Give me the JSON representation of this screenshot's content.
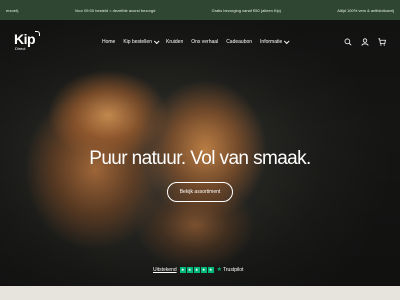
{
  "announcement": {
    "left": "erzoet)",
    "center_left": "Voor 09:00 besteld = dezelfde avond bezorgd",
    "center_right": "Gratis bezorging vanaf €50 (alleen Kip)",
    "right": "Altijd 100% vers & antibioticavrij",
    "background": "#2f4732"
  },
  "logo": {
    "main": "Kip",
    "sub": "Direct"
  },
  "nav": {
    "items": [
      {
        "label": "Home"
      },
      {
        "label": "Kip bestellen"
      },
      {
        "label": "Kruiden"
      },
      {
        "label": "Ons verhaal"
      },
      {
        "label": "Cadeaubon"
      },
      {
        "label": "Informatie"
      }
    ]
  },
  "header_icons": [
    "search-icon",
    "account-icon",
    "cart-icon"
  ],
  "hero": {
    "headline": "Puur natuur. Vol van smaak.",
    "cta_label": "Bekijk assortiment"
  },
  "trustpilot": {
    "rating_text": "Uitstekend",
    "stars": 5,
    "brand": "Trustpilot",
    "color": "#00b67a"
  }
}
